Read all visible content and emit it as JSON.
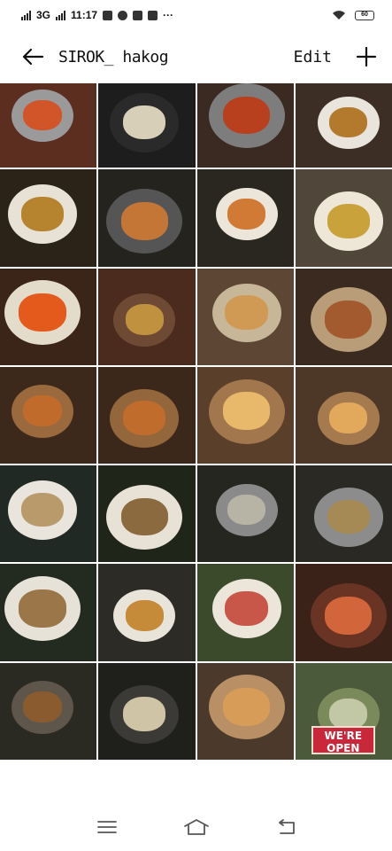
{
  "status_bar": {
    "network": "3G",
    "time": "11:17",
    "battery": "60",
    "more": "···"
  },
  "app_bar": {
    "title": "SIROK_ hakog",
    "edit_label": "Edit"
  },
  "photos": [
    {
      "theme": "shrimp-pan",
      "bg": "#5b2e20",
      "plate": "#9a9a9a",
      "food": "#d2552a"
    },
    {
      "theme": "pancit",
      "bg": "#1d1d1d",
      "plate": "#2a2a2a",
      "food": "#d8cfb8"
    },
    {
      "theme": "prawns-pot",
      "bg": "#3a2a22",
      "plate": "#7d7d7d",
      "food": "#b8401f"
    },
    {
      "theme": "soup-bowl",
      "bg": "#3c2e25",
      "plate": "#e9e4dc",
      "food": "#b37a2e"
    },
    {
      "theme": "sinigang",
      "bg": "#2b2218",
      "plate": "#e8e2d6",
      "food": "#b6832e"
    },
    {
      "theme": "shrimp-bowl",
      "bg": "#24231e",
      "plate": "#555",
      "food": "#c47637"
    },
    {
      "theme": "tom-yum",
      "bg": "#2a2620",
      "plate": "#ece6da",
      "food": "#d07a35"
    },
    {
      "theme": "broth-spoon",
      "bg": "#50463a",
      "plate": "#eee7d8",
      "food": "#c9a23b"
    },
    {
      "theme": "carrot-fries",
      "bg": "#3a2518",
      "plate": "#e4dccb",
      "food": "#e35a1c"
    },
    {
      "theme": "lumpia",
      "bg": "#4a2b1e",
      "plate": "#6e4a34",
      "food": "#c0913f"
    },
    {
      "theme": "burger-board",
      "bg": "#5d4634",
      "plate": "#c7b698",
      "food": "#d09a55"
    },
    {
      "theme": "burger",
      "bg": "#3b2a20",
      "plate": "#b89d78",
      "food": "#a35a2e"
    },
    {
      "theme": "spaghetti-sandwich",
      "bg": "#3d291b",
      "plate": "#9a6a3e",
      "food": "#c06a2c"
    },
    {
      "theme": "spaghetti-sandwich-2",
      "bg": "#3b281a",
      "plate": "#94663c",
      "food": "#bf6c2d"
    },
    {
      "theme": "pizza",
      "bg": "#5a3f2a",
      "plate": "#a2774d",
      "food": "#e8b96a"
    },
    {
      "theme": "pizza-2",
      "bg": "#4d3827",
      "plate": "#a57a4e",
      "food": "#e2a85c"
    },
    {
      "theme": "clam-soup",
      "bg": "#202923",
      "plate": "#e9e5dc",
      "food": "#b89a6b"
    },
    {
      "theme": "vegetable-soup",
      "bg": "#1f2619",
      "plate": "#e7e1d6",
      "food": "#8b6a3f"
    },
    {
      "theme": "pot-veg",
      "bg": "#262620",
      "plate": "#8a8a8a",
      "food": "#b7b4a6"
    },
    {
      "theme": "pot-soup",
      "bg": "#2a2923",
      "plate": "#8c8c8c",
      "food": "#a58a56"
    },
    {
      "theme": "beans-soup",
      "bg": "#232a1f",
      "plate": "#e7e2d8",
      "food": "#9a7648"
    },
    {
      "theme": "wok-soup",
      "bg": "#2c2b26",
      "plate": "#e9e4da",
      "food": "#c58b39"
    },
    {
      "theme": "ceviche",
      "bg": "#3b4a2a",
      "plate": "#ebe5da",
      "food": "#c8574a"
    },
    {
      "theme": "shrimp-close",
      "bg": "#3b2218",
      "plate": "#6a3424",
      "food": "#d2653a"
    },
    {
      "theme": "stew-pan",
      "bg": "#2b2a22",
      "plate": "#5e554b",
      "food": "#8a5b2e"
    },
    {
      "theme": "pancit-close",
      "bg": "#1f1f1c",
      "plate": "#3c3a36",
      "food": "#cfc4a6"
    },
    {
      "theme": "pizza-board",
      "bg": "#4b3a2b",
      "plate": "#b99065",
      "food": "#d79c58"
    },
    {
      "theme": "were-open",
      "bg": "#4a5a3a",
      "plate": "#7a8a5a",
      "food": "#c2c8a6"
    }
  ],
  "open_sign": {
    "line1": "WE'RE",
    "line2": "OPEN"
  }
}
